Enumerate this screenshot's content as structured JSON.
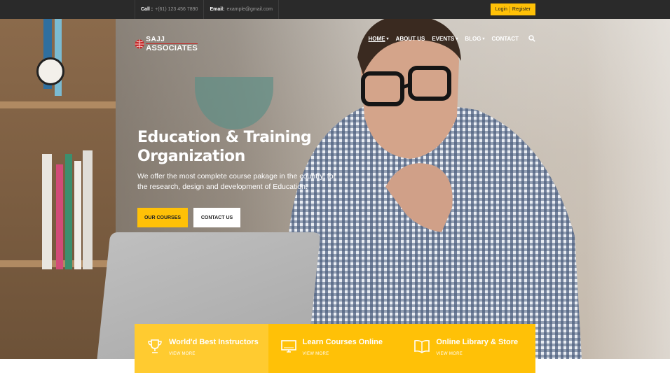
{
  "topbar": {
    "call_label": "Call :",
    "call_value": "+(61) 123 456 7890",
    "email_label": "Email:",
    "email_value": "example@gmail.com",
    "login": "Login",
    "register": "Register"
  },
  "logo": {
    "line1": "SAJJ",
    "line2": "ASSOCIATES"
  },
  "nav": {
    "items": [
      {
        "label": "HOME",
        "caret": "▾"
      },
      {
        "label": "ABOUT US",
        "caret": ""
      },
      {
        "label": "EVENTS",
        "caret": "▾"
      },
      {
        "label": "BLOG",
        "caret": "▾"
      },
      {
        "label": "CONTACT",
        "caret": ""
      }
    ]
  },
  "hero": {
    "title": "Education & Training Organization",
    "subtitle": "We offer the most complete course pakage in the country, for the research, design and development of Education.",
    "primary_button": "OUR COURSES",
    "secondary_button": "CONTACT US"
  },
  "features": [
    {
      "title": "World'd Best Instructors",
      "more": "VIEW MORE",
      "icon": "trophy-icon"
    },
    {
      "title": "Learn Courses Online",
      "more": "VIEW MORE",
      "icon": "monitor-icon"
    },
    {
      "title": "Online Library & Store",
      "more": "VIEW MORE",
      "icon": "book-icon"
    }
  ],
  "colors": {
    "accent": "#ffc107",
    "topbar": "#2a2a2a",
    "logo_red": "#c62828"
  }
}
